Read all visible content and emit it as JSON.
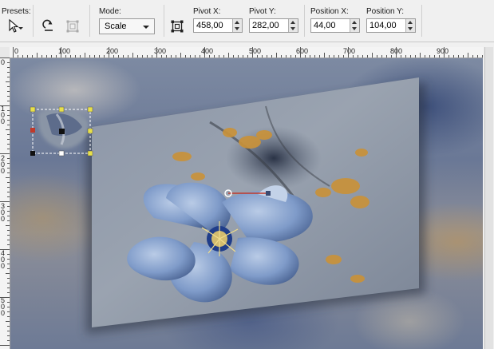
{
  "toolbar": {
    "presets_label": "Presets:",
    "mode_label": "Mode:",
    "mode_value": "Scale",
    "pivot_x_label": "Pivot X:",
    "pivot_x_value": "458,00",
    "pivot_y_label": "Pivot Y:",
    "pivot_y_value": "282,00",
    "position_x_label": "Position X:",
    "position_x_value": "44,00",
    "position_y_label": "Position Y:",
    "position_y_value": "104,00"
  },
  "ruler": {
    "h_labels": [
      "0",
      "100",
      "200",
      "300",
      "400",
      "500",
      "600",
      "700",
      "800",
      "900"
    ],
    "v_labels": [
      "0",
      "1 0 0",
      "2 0 0",
      "3 0 0",
      "4 0 0",
      "5 0 0"
    ]
  },
  "icons": {
    "preset": "pointer-icon",
    "reset": "reset-arrow-icon",
    "dim": "transform-icon",
    "pivot": "pivot-frame-icon"
  },
  "colors": {
    "handle_yellow": "#e8e04a",
    "handle_red": "#c0392b",
    "selection_line": "#ffffff"
  }
}
